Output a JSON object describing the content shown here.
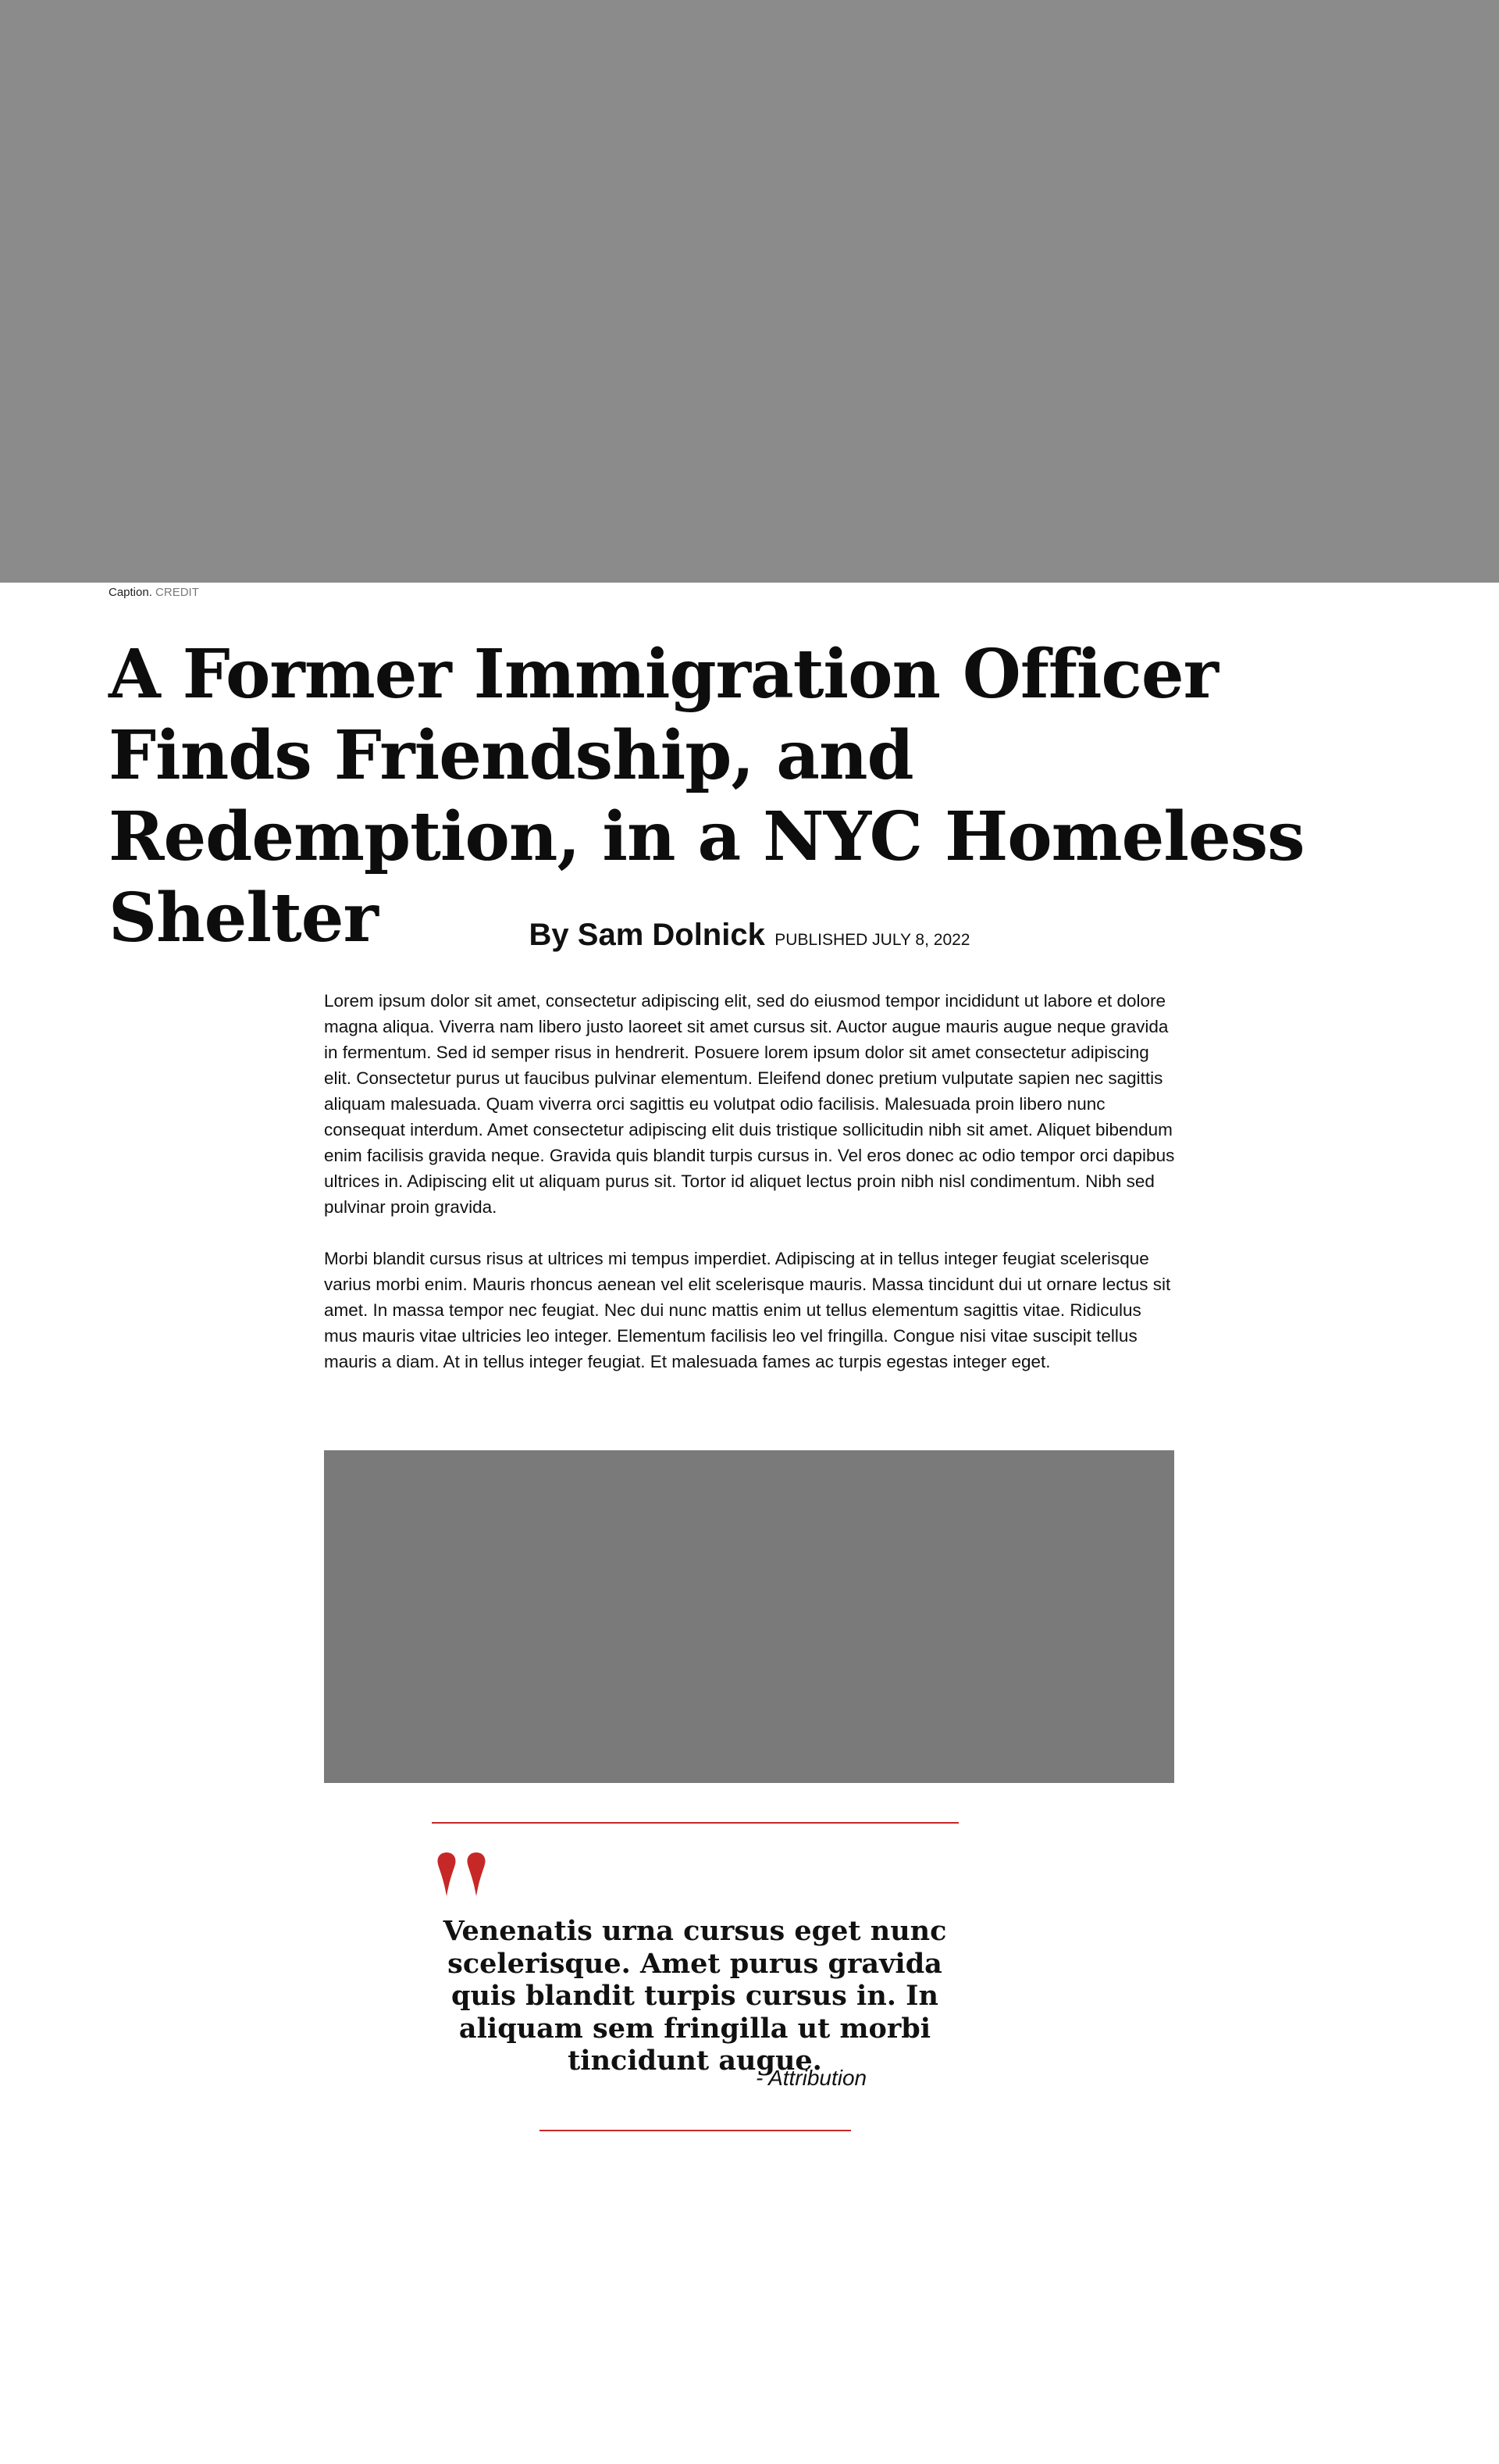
{
  "hero": {
    "caption": "Caption.",
    "credit": "CREDIT"
  },
  "article": {
    "headline": "A Former Immigration Officer Finds Friendship, and Redemption, in a NYC Homeless Shelter",
    "author": "By Sam Dolnick",
    "published": "PUBLISHED JULY 8, 2022",
    "paragraphs": [
      "Lorem ipsum dolor sit amet, consectetur adipiscing elit, sed do eiusmod tempor incididunt ut labore et dolore magna aliqua. Viverra nam libero justo laoreet sit amet cursus sit. Auctor augue mauris augue neque gravida in fermentum. Sed id semper risus in hendrerit. Posuere lorem ipsum dolor sit amet consectetur adipiscing elit. Consectetur purus ut faucibus pulvinar elementum. Eleifend donec pretium vulputate sapien nec sagittis aliquam malesuada. Quam viverra orci sagittis eu volutpat odio facilisis. Malesuada proin libero nunc consequat interdum. Amet consectetur adipiscing elit duis tristique sollicitudin nibh sit amet. Aliquet bibendum enim facilisis gravida neque. Gravida quis blandit turpis cursus in. Vel eros donec ac odio tempor orci dapibus ultrices in. Adipiscing elit ut aliquam purus sit. Tortor id aliquet lectus proin nibh nisl condimentum. Nibh sed pulvinar proin gravida.",
      "Morbi blandit cursus risus at ultrices mi tempus imperdiet. Adipiscing at in tellus integer feugiat scelerisque varius morbi enim. Mauris rhoncus aenean vel elit scelerisque mauris. Massa tincidunt dui ut ornare lectus sit amet. In massa tempor nec feugiat. Nec dui nunc mattis enim ut tellus elementum sagittis vitae. Ridiculus mus mauris vitae ultricies leo integer. Elementum facilisis leo vel fringilla. Congue nisi vitae suscipit tellus mauris a diam. At in tellus integer feugiat. Et malesuada fames ac turpis egestas integer eget."
    ]
  },
  "pullquote": {
    "text": "Venenatis urna cursus eget nunc scelerisque. Amet purus gravida quis blandit turpis cursus in. In aliquam sem fringilla ut morbi tincidunt augue.",
    "attribution": "- Attribution"
  },
  "colors": {
    "accent": "#c62828",
    "hero_placeholder": "#8b8b8b",
    "inline_placeholder": "#7a7a7a"
  },
  "icons": {
    "quote": "quote-mark-icon"
  }
}
